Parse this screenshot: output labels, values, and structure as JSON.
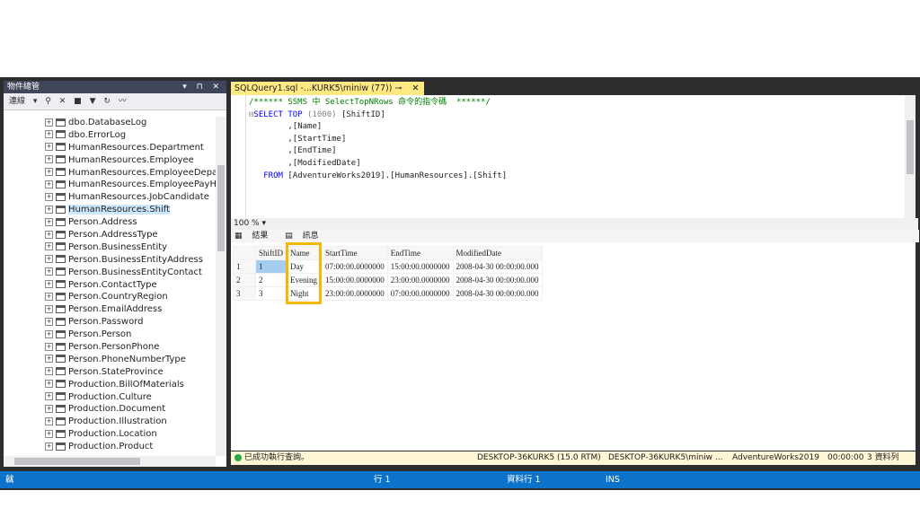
{
  "object_explorer": {
    "title": "物件總管",
    "toolbar": {
      "connect": "連線"
    },
    "tables": [
      "dbo.DatabaseLog",
      "dbo.ErrorLog",
      "HumanResources.Department",
      "HumanResources.Employee",
      "HumanResources.EmployeeDepartm",
      "HumanResources.EmployeePayHisto",
      "HumanResources.JobCandidate",
      "HumanResources.Shift",
      "Person.Address",
      "Person.AddressType",
      "Person.BusinessEntity",
      "Person.BusinessEntityAddress",
      "Person.BusinessEntityContact",
      "Person.ContactType",
      "Person.CountryRegion",
      "Person.EmailAddress",
      "Person.Password",
      "Person.Person",
      "Person.PersonPhone",
      "Person.PhoneNumberType",
      "Person.StateProvince",
      "Production.BillOfMaterials",
      "Production.Culture",
      "Production.Document",
      "Production.Illustration",
      "Production.Location",
      "Production.Product"
    ],
    "selected_index": 7
  },
  "editor": {
    "tab_label": "SQLQuery1.sql -...KURK5\\miniw (77))",
    "code": {
      "line1": "/****** SSMS 中 SelectTopNRows 命令的指令碼  ******/",
      "line2_kw": "SELECT TOP ",
      "line2_num": "(1000) ",
      "line2_col": "[ShiftID]",
      "line3": ",[Name]",
      "line4": ",[StartTime]",
      "line5": ",[EndTime]",
      "line6": ",[ModifiedDate]",
      "line7_kw": "FROM ",
      "line7_tbl": "[AdventureWorks2019].[HumanResources].[Shift]"
    },
    "zoom": "100 %"
  },
  "results": {
    "tab_results": "結果",
    "tab_messages": "訊息",
    "columns": [
      "ShiftID",
      "Name",
      "StartTime",
      "EndTime",
      "ModifiedDate"
    ],
    "rows": [
      [
        "1",
        "1",
        "Day",
        "07:00:00.0000000",
        "15:00:00.0000000",
        "2008-04-30 00:00:00.000"
      ],
      [
        "2",
        "2",
        "Evening",
        "15:00:00.0000000",
        "23:00:00.0000000",
        "2008-04-30 00:00:00.000"
      ],
      [
        "3",
        "3",
        "Night",
        "23:00:00.0000000",
        "07:00:00.0000000",
        "2008-04-30 00:00:00.000"
      ]
    ]
  },
  "query_status": {
    "message": "已成功執行查詢。",
    "server": "DESKTOP-36KURK5 (15.0 RTM)",
    "user": "DESKTOP-36KURK5\\miniw ...",
    "database": "AdventureWorks2019",
    "time": "00:00:00",
    "rows": "3 資料列"
  },
  "app_status": {
    "ready": "就緒",
    "line": "行 1",
    "column": "資料行 1",
    "mode": "INS"
  },
  "colors": {
    "accent": "#0d72c9",
    "highlight": "#f5b800",
    "tab": "#ffe983"
  }
}
